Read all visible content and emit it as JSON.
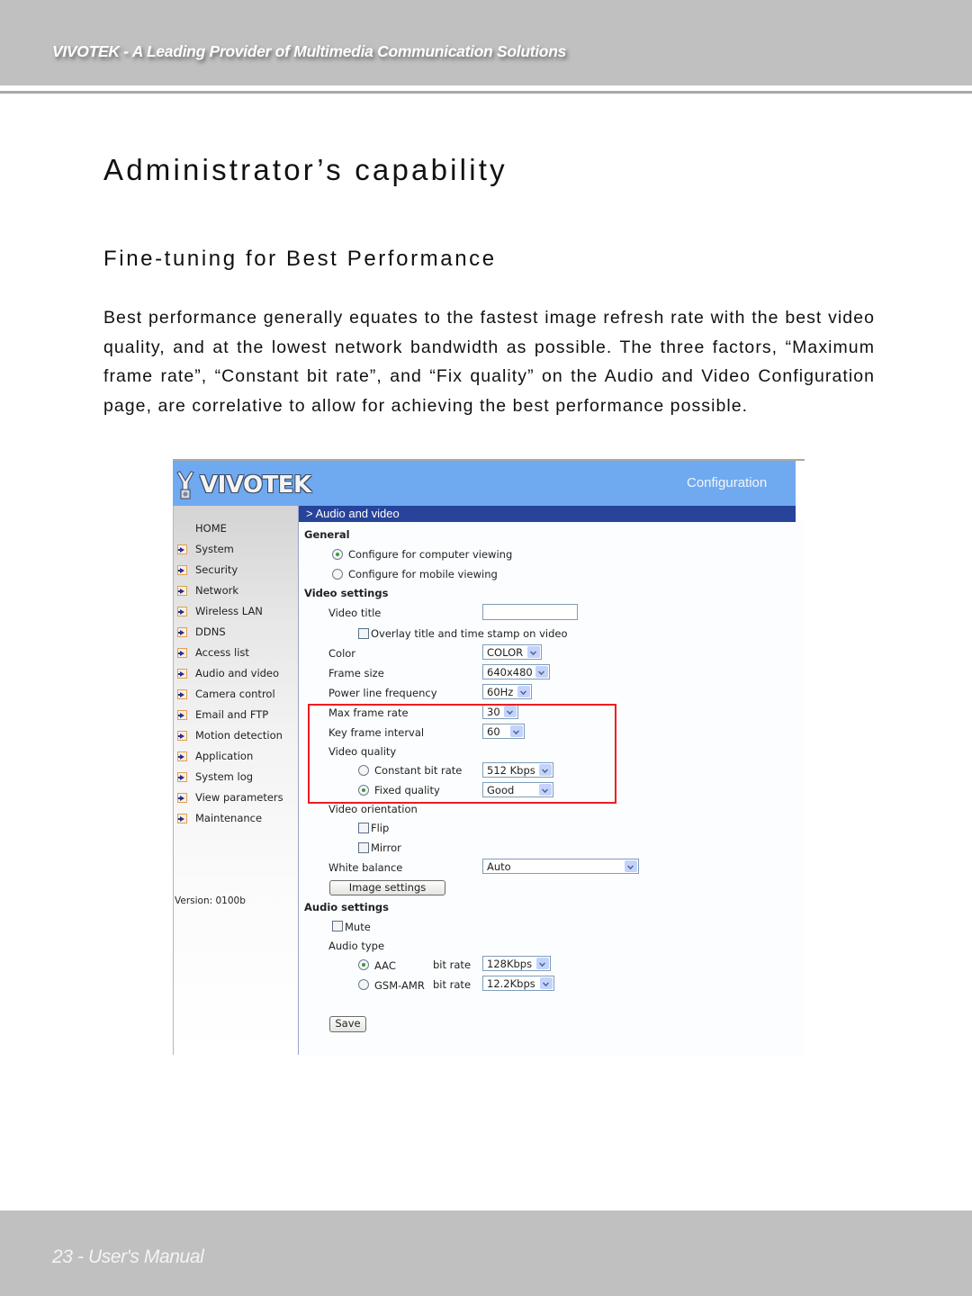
{
  "page_header": {
    "tagline": "VIVOTEK - A Leading Provider of Multimedia Communication Solutions"
  },
  "document": {
    "title": "Administrator’s capability",
    "subtitle": "Fine-tuning for Best Performance",
    "paragraph": "Best performance generally equates to the fastest image refresh rate with the best video quality, and at the lowest network bandwidth as possible. The three factors, “Maximum frame rate”, “Constant bit rate”, and “Fix quality” on the Audio and Video Configuration page, are correlative to allow for achieving the best performance possible."
  },
  "screenshot": {
    "logo_text": "VIVOTEK",
    "banner_title": "Configuration",
    "section_title": "> Audio and video",
    "colors": {
      "banner": "#6fa9ef",
      "section_bar": "#27439a",
      "highlight_box": "#ee1c24"
    },
    "sidebar": {
      "home": "HOME",
      "items": [
        {
          "label": "System"
        },
        {
          "label": "Security"
        },
        {
          "label": "Network"
        },
        {
          "label": "Wireless LAN"
        },
        {
          "label": "DDNS"
        },
        {
          "label": "Access list"
        },
        {
          "label": "Audio and video"
        },
        {
          "label": "Camera control"
        },
        {
          "label": "Email and FTP"
        },
        {
          "label": "Motion detection"
        },
        {
          "label": "Application"
        },
        {
          "label": "System log"
        },
        {
          "label": "View parameters"
        },
        {
          "label": "Maintenance"
        }
      ],
      "version": "Version: 0100b"
    },
    "general": {
      "heading": "General",
      "options": [
        {
          "label": "Configure for computer viewing",
          "selected": true
        },
        {
          "label": "Configure for mobile viewing",
          "selected": false
        }
      ]
    },
    "video": {
      "heading": "Video settings",
      "video_title_label": "Video title",
      "video_title_value": "",
      "overlay_label": "Overlay title and time stamp on video",
      "overlay_checked": false,
      "color_label": "Color",
      "color_value": "COLOR",
      "frame_size_label": "Frame size",
      "frame_size_value": "640x480",
      "power_line_label": "Power line frequency",
      "power_line_value": "60Hz",
      "max_frame_rate_label": "Max frame rate",
      "max_frame_rate_value": "30",
      "key_frame_label": "Key frame interval",
      "key_frame_value": "60",
      "quality_label": "Video quality",
      "cbr_label": "Constant bit rate",
      "cbr_value": "512 Kbps",
      "cbr_selected": false,
      "fixed_label": "Fixed quality",
      "fixed_value": "Good",
      "fixed_selected": true,
      "orientation_label": "Video orientation",
      "flip_label": "Flip",
      "mirror_label": "Mirror",
      "white_balance_label": "White balance",
      "white_balance_value": "Auto",
      "image_settings_button": "Image settings"
    },
    "audio": {
      "heading": "Audio settings",
      "mute_label": "Mute",
      "type_label": "Audio type",
      "aac_label": "AAC",
      "aac_bitrate_label": "bit rate",
      "aac_bitrate_value": "128Kbps",
      "aac_selected": true,
      "gsm_label": "GSM-AMR",
      "gsm_bitrate_label": "bit rate",
      "gsm_bitrate_value": "12.2Kbps",
      "gsm_selected": false
    },
    "save_button": "Save"
  },
  "page_footer": {
    "page_label": "23 - User's Manual"
  }
}
